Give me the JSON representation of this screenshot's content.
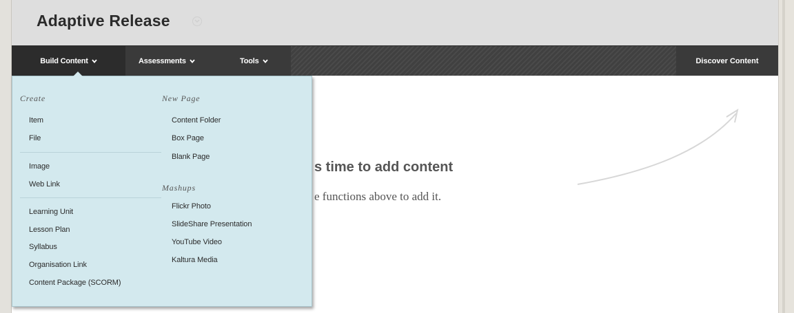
{
  "header": {
    "title": "Adaptive Release"
  },
  "menubar": {
    "build_content": "Build Content",
    "assessments": "Assessments",
    "tools": "Tools",
    "discover_content": "Discover Content"
  },
  "empty_state": {
    "title": "s time to add content",
    "subtitle": "e functions above to add it."
  },
  "dropdown": {
    "create_heading": "Create",
    "create_items": [
      "Item",
      "File",
      "Image",
      "Web Link",
      "Learning Unit",
      "Lesson Plan",
      "Syllabus",
      "Organisation Link",
      "Content Package (SCORM)"
    ],
    "new_page_heading": "New Page",
    "new_page_items": [
      "Content Folder",
      "Box Page",
      "Blank Page"
    ],
    "mashups_heading": "Mashups",
    "mashups_items": [
      "Flickr Photo",
      "SlideShare Presentation",
      "YouTube Video",
      "Kaltura Media"
    ]
  }
}
